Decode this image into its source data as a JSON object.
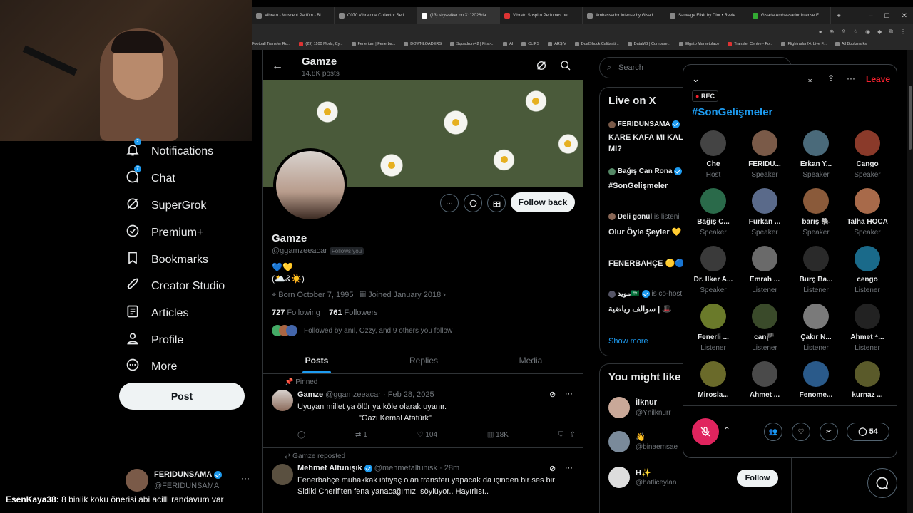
{
  "browser": {
    "tabs": [
      {
        "label": "Vibrato - Muscent Parfüm - Bi..."
      },
      {
        "label": "C070 Vibratone Collector Seri..."
      },
      {
        "label": "(13) skywalker on X: \"2026da..."
      },
      {
        "label": "Vibrato Sospiro Perfumes per..."
      },
      {
        "label": "Ambassador Intense by Gisad..."
      },
      {
        "label": "Sauvage Elixir by Dior • Revie..."
      },
      {
        "label": "Gisada Ambassador Intense E..."
      }
    ],
    "bookmarks": [
      "Football Transfer Ru...",
      "(29) 1100 Mods, Cy...",
      "Fenerium | Fenerba...",
      "DOWNLOADERS",
      "Squadron 42 | First-...",
      "AI",
      "CLIPS",
      "ARŞİV",
      "DualShock Calibrati...",
      "DataMB | Compare...",
      "Elgato Marketplace",
      "Transfer Centre - Fo...",
      "Flightradar24: Live F...",
      "All Bookmarks"
    ]
  },
  "nav": {
    "items": [
      {
        "label": "Notifications",
        "badge": "2"
      },
      {
        "label": "Chat",
        "badge": "7"
      },
      {
        "label": "SuperGrok"
      },
      {
        "label": "Premium+"
      },
      {
        "label": "Bookmarks"
      },
      {
        "label": "Creator Studio"
      },
      {
        "label": "Articles"
      },
      {
        "label": "Profile"
      },
      {
        "label": "More"
      }
    ],
    "post_label": "Post",
    "account": {
      "name": "FERIDUNSAMA",
      "handle": "@FERIDUNSAMA",
      "more": "···"
    }
  },
  "chat_overlay": {
    "user": "EsenKaya38:",
    "message": "8 binlik koku önerisi abi acilll randavum var"
  },
  "profile": {
    "header_name": "Gamze",
    "header_posts": "14.8K posts",
    "name": "Gamze",
    "handle": "@ggamzeeacar",
    "follows_you": "Follows you",
    "bio_line1": "💙💛",
    "bio_line2": "(🌥️&☀️)",
    "born": "Born October 7, 1995",
    "joined": "Joined January 2018",
    "following_count": "727",
    "following_label": "Following",
    "followers_count": "761",
    "followers_label": "Followers",
    "followed_by": "Followed by anıl, Ozzy, and 9 others you follow",
    "follow_back": "Follow back",
    "tabs": [
      "Posts",
      "Replies",
      "Media"
    ]
  },
  "tweets": [
    {
      "context": "Pinned",
      "name": "Gamze",
      "handle": "@ggamzeeacar",
      "date": "· Feb 28, 2025",
      "text1": "Uyuyan millet ya ölür ya köle olarak uyanır.",
      "text2": "\"Gazi Kemal Atatürk\"",
      "reposts": "1",
      "likes": "104",
      "views": "18K"
    },
    {
      "context": "Gamze reposted",
      "name": "Mehmet Altunışık",
      "handle": "@mehmetaltunisk",
      "date": "· 28m",
      "text1": "Fenerbahçe muhakkak ihtiyaç olan transferi yapacak da içinden bir ses bir",
      "text2": "Sidiki Cherif'ten fena yanacağımızı söylüyor.. Hayırlısı.."
    }
  ],
  "right": {
    "search_placeholder": "Search",
    "live_title": "Live on X",
    "live_items": [
      {
        "user": "FERIDUNSAMA",
        "text": "KARE KAFA MI KAL",
        "text2": "MI?"
      },
      {
        "user": "Bağış Can Rona",
        "text": "#SonGelişmeler"
      },
      {
        "user": "Deli gönül",
        "suffix": "is listeni",
        "text": "Olur Öyle Şeyler 💛"
      },
      {
        "user": "",
        "text": "FENERBAHÇE 🟡🔵"
      },
      {
        "user": "مويد🇸🇦",
        "suffix": "is co-host",
        "text": "سوالف رياضية | 🎩"
      }
    ],
    "show_more": "Show more",
    "wtf_title": "You might like",
    "wtf": [
      {
        "name": "İlknur",
        "handle": "@Ynilknurr"
      },
      {
        "name": "👋",
        "handle": "@binaemsae"
      },
      {
        "name": "H✨",
        "handle": "@hatliceylan",
        "button": "Follow"
      }
    ]
  },
  "space": {
    "leave": "Leave",
    "rec": "REC",
    "title": "#SonGelişmeler",
    "participants": [
      {
        "name": "Che",
        "role": "Host"
      },
      {
        "name": "FERIDU...",
        "role": "Speaker"
      },
      {
        "name": "Erkan Y...",
        "role": "Speaker"
      },
      {
        "name": "Cango",
        "role": "Speaker"
      },
      {
        "name": "Bağış C...",
        "role": "Speaker"
      },
      {
        "name": "Furkan ...",
        "role": "Speaker"
      },
      {
        "name": "barış 🐘",
        "role": "Speaker"
      },
      {
        "name": "Talha HOCA",
        "role": "Speaker"
      },
      {
        "name": "Dr. İlker A...",
        "role": "Speaker"
      },
      {
        "name": "Emrah ...",
        "role": "Listener"
      },
      {
        "name": "Burç Ba...",
        "role": "Listener"
      },
      {
        "name": "cengo",
        "role": "Listener"
      },
      {
        "name": "Fenerli ...",
        "role": "Listener"
      },
      {
        "name": "can🏴",
        "role": "Listener"
      },
      {
        "name": "Çakır N...",
        "role": "Listener"
      },
      {
        "name": "Ahmet ⁴...",
        "role": "Listener"
      },
      {
        "name": "Miroslа...",
        "role": ""
      },
      {
        "name": "Ahmet ...",
        "role": ""
      },
      {
        "name": "Fenome...",
        "role": ""
      },
      {
        "name": "kurnaz ...",
        "role": ""
      }
    ],
    "comment_count": "54"
  },
  "colors": {
    "accent": "#1d9bf0",
    "leave": "#f4212e",
    "mic": "#e0245e"
  }
}
